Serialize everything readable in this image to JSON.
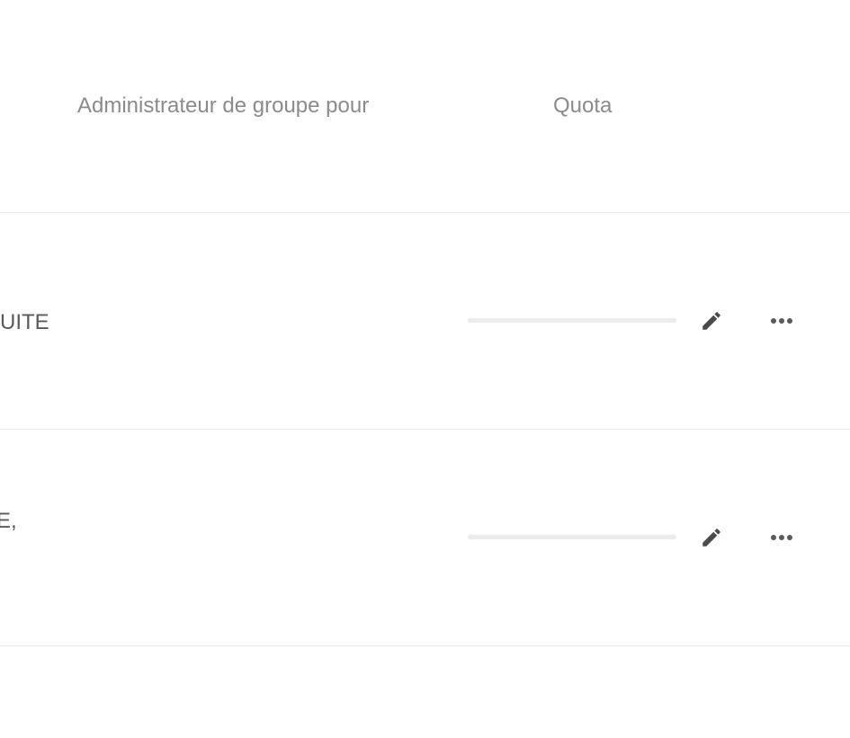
{
  "table": {
    "headers": {
      "admin": "Administrateur de groupe pour",
      "quota": "Quota"
    },
    "rows": [
      {
        "admin_text": "UITE",
        "quota_fraction": 0,
        "edit_icon": "pencil-icon",
        "more_icon": "more-horizontal-icon"
      },
      {
        "admin_text": "E,",
        "quota_fraction": 0,
        "edit_icon": "pencil-icon",
        "more_icon": "more-horizontal-icon"
      }
    ]
  },
  "colors": {
    "header_text": "#8b8b8b",
    "row_text": "#5a5a5a",
    "divider": "#ebebeb",
    "quota_track": "#ececec",
    "icon": "#4a4a4a"
  }
}
